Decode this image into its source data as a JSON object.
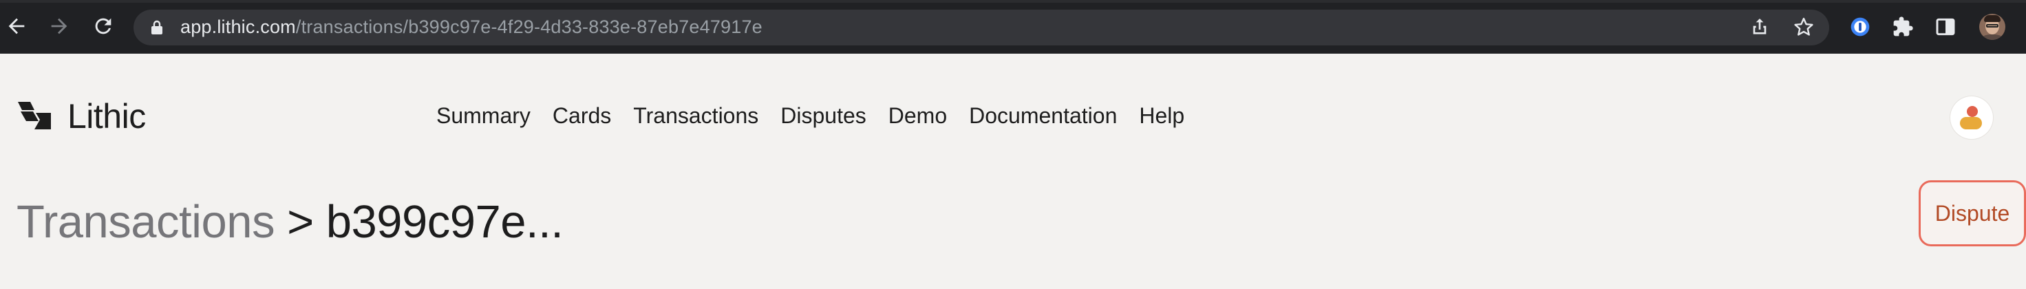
{
  "browser": {
    "url_host": "app.lithic.com",
    "url_path": "/transactions/b399c97e-4f29-4d33-833e-87eb7e47917e",
    "icons": [
      "back-arrow-icon",
      "forward-arrow-icon",
      "reload-icon",
      "lock-icon",
      "share-icon",
      "star-icon",
      "password-manager-icon",
      "puzzle-extension-icon",
      "sidebar-icon",
      "profile-avatar"
    ]
  },
  "header": {
    "logo_text": "Lithic",
    "nav": [
      "Summary",
      "Cards",
      "Transactions",
      "Disputes",
      "Demo",
      "Documentation",
      "Help"
    ]
  },
  "page": {
    "breadcrumb_parent": "Transactions",
    "breadcrumb_separator": ">",
    "transaction_id_short": "b399c97e...",
    "dispute_label": "Dispute"
  },
  "colors": {
    "chrome_bg": "#202124",
    "page_bg": "#f3f2f0",
    "dispute_border": "#e96a5a",
    "dispute_text": "#b24a25",
    "avatar_head": "#e0604a",
    "avatar_body": "#e8a93a"
  }
}
